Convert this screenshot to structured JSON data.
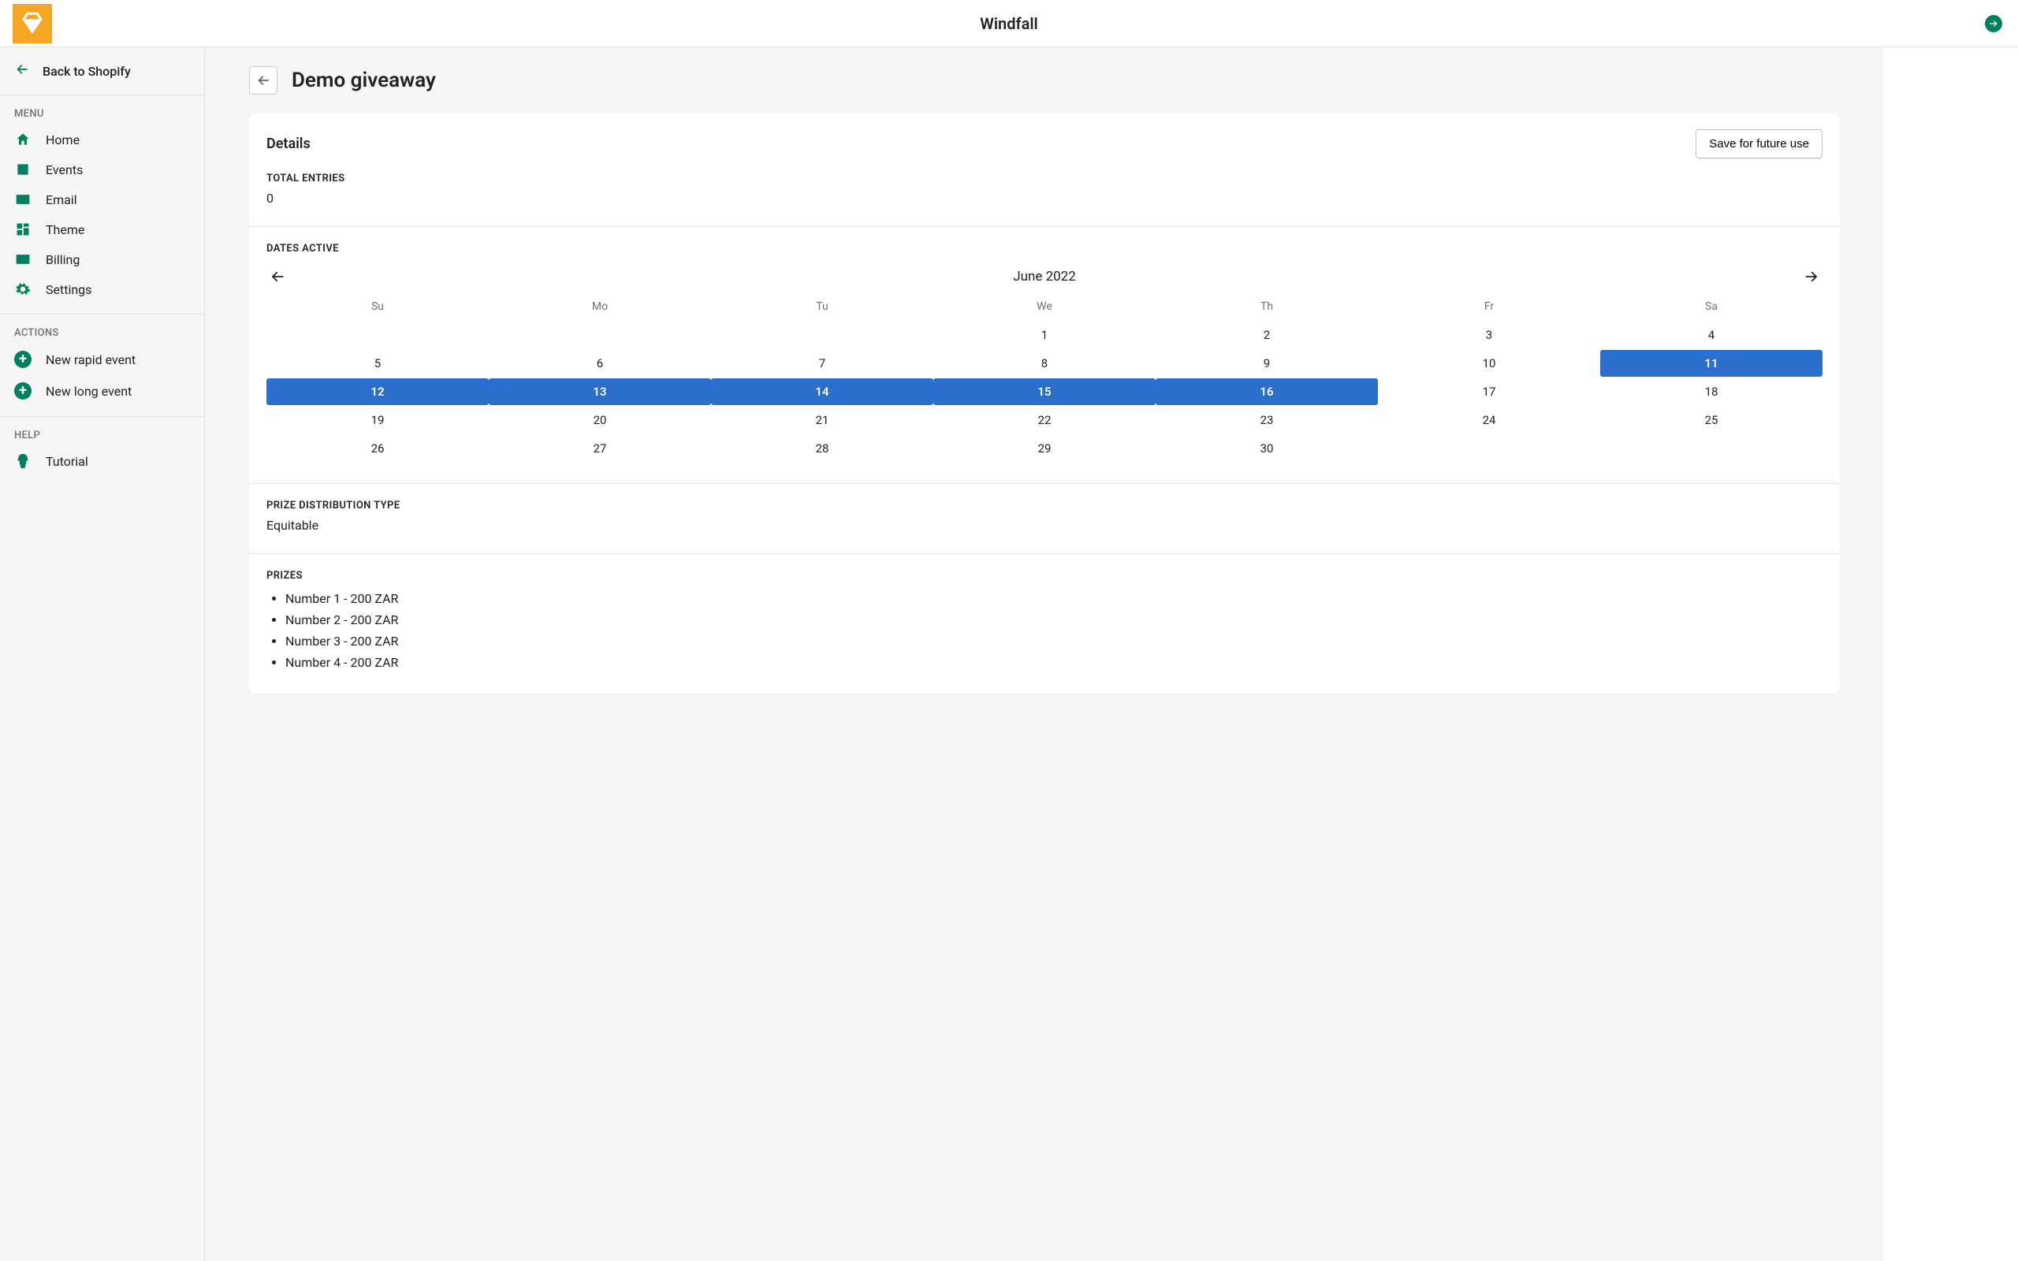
{
  "app": {
    "title": "Windfall"
  },
  "sidebar": {
    "back_label": "Back to Shopify",
    "menu_title": "MENU",
    "items": [
      {
        "label": "Home"
      },
      {
        "label": "Events"
      },
      {
        "label": "Email"
      },
      {
        "label": "Theme"
      },
      {
        "label": "Billing"
      },
      {
        "label": "Settings"
      }
    ],
    "actions_title": "ACTIONS",
    "actions": [
      {
        "label": "New rapid event"
      },
      {
        "label": "New long event"
      }
    ],
    "help_title": "HELP",
    "help": [
      {
        "label": "Tutorial"
      }
    ]
  },
  "page": {
    "title": "Demo giveaway",
    "details_heading": "Details",
    "save_button": "Save for future use",
    "total_entries_label": "TOTAL ENTRIES",
    "total_entries_value": "0",
    "dates_active_label": "DATES ACTIVE",
    "calendar": {
      "month_label": "June 2022",
      "days_of_week": [
        "Su",
        "Mo",
        "Tu",
        "We",
        "Th",
        "Fr",
        "Sa"
      ],
      "leading_blanks": 3,
      "days_in_month": 30,
      "selected": [
        11,
        12,
        13,
        14,
        15,
        16
      ]
    },
    "prize_dist_label": "PRIZE DISTRIBUTION TYPE",
    "prize_dist_value": "Equitable",
    "prizes_label": "PRIZES",
    "prizes": [
      "Number 1 - 200 ZAR",
      "Number 2 - 200 ZAR",
      "Number 3 - 200 ZAR",
      "Number 4 - 200 ZAR"
    ]
  }
}
